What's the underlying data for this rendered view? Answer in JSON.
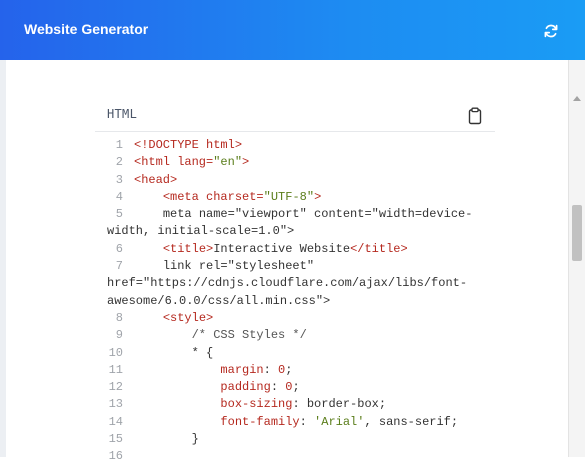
{
  "header": {
    "title": "Website Generator",
    "refresh_icon": "refresh-icon"
  },
  "panel": {
    "label": "HTML",
    "copy_icon": "clipboard-icon"
  },
  "code_lines": [
    {
      "n": "1",
      "t": "<!DOCTYPE html>"
    },
    {
      "n": "2",
      "t": "<html lang=\"en\">"
    },
    {
      "n": "3",
      "t": "<head>"
    },
    {
      "n": "4",
      "t": "    <meta charset=\"UTF-8\">"
    },
    {
      "n": "5",
      "t": "    <meta name=\"viewport\" content=\"width=device-width, initial-scale=1.0\">"
    },
    {
      "n": "6",
      "t": "    <title>Interactive Website</title>"
    },
    {
      "n": "7",
      "t": "    <link rel=\"stylesheet\" href=\"https://cdnjs.cloudflare.com/ajax/libs/font-awesome/6.0.0/css/all.min.css\">"
    },
    {
      "n": "8",
      "t": "    <style>"
    },
    {
      "n": "9",
      "t": "        /* CSS Styles */"
    },
    {
      "n": "10",
      "t": "        * {"
    },
    {
      "n": "11",
      "t": "            margin: 0;"
    },
    {
      "n": "12",
      "t": "            padding: 0;"
    },
    {
      "n": "13",
      "t": "            box-sizing: border-box;"
    },
    {
      "n": "14",
      "t": "            font-family: 'Arial', sans-serif;"
    },
    {
      "n": "15",
      "t": "        }"
    },
    {
      "n": "16",
      "t": ""
    }
  ]
}
